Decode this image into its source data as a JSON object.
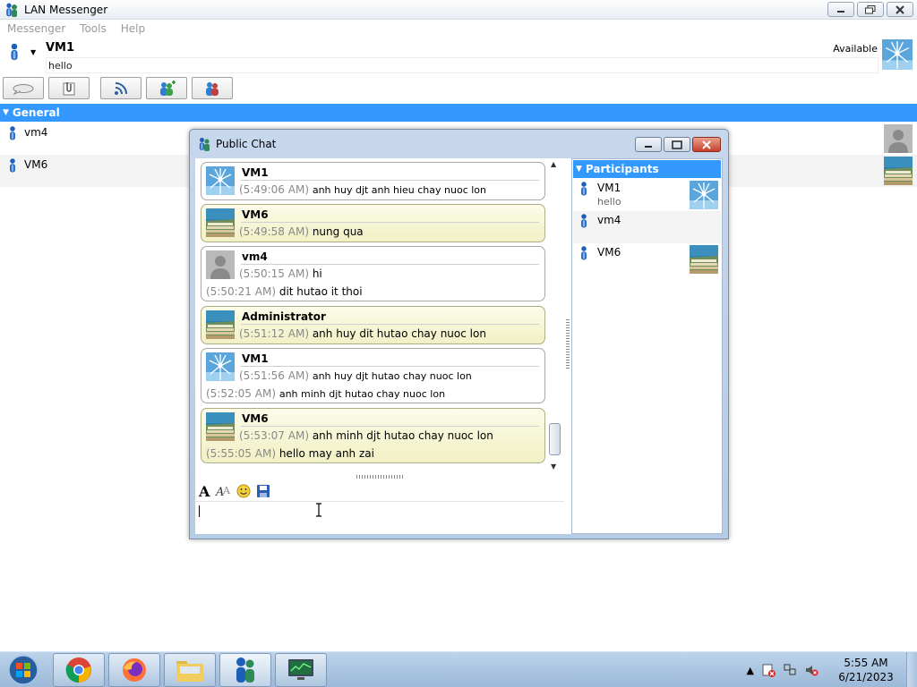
{
  "window": {
    "title": "LAN Messenger"
  },
  "menu": [
    "Messenger",
    "Tools",
    "Help"
  ],
  "profile": {
    "name": "VM1",
    "status_message": "hello",
    "availability": "Available"
  },
  "groups": [
    {
      "name": "General",
      "buddies": [
        {
          "name": "vm4",
          "avatar": "default-person-icon"
        },
        {
          "name": "VM6",
          "avatar": "stairs-photo"
        }
      ]
    }
  ],
  "chat": {
    "title": "Public Chat",
    "messages": [
      {
        "sender": "VM1",
        "avatar": "windmill-photo",
        "lines": [
          {
            "time": "(5:49:06 AM)",
            "text": "anh huy djt anh hieu chay nuoc lon"
          }
        ]
      },
      {
        "sender": "VM6",
        "avatar": "stairs-photo",
        "lines": [
          {
            "time": "(5:49:58 AM)",
            "text": "nung qua"
          }
        ]
      },
      {
        "sender": "vm4",
        "avatar": "default-person-icon",
        "lines": [
          {
            "time": "(5:50:15 AM)",
            "text": "hi"
          },
          {
            "time": "(5:50:21 AM)",
            "text": "dit hutao it thoi"
          }
        ]
      },
      {
        "sender": "Administrator",
        "avatar": "stairs-photo",
        "lines": [
          {
            "time": "(5:51:12 AM)",
            "text": "anh huy dit hutao chay nuoc lon"
          }
        ]
      },
      {
        "sender": "VM1",
        "avatar": "windmill-photo",
        "lines": [
          {
            "time": "(5:51:56 AM)",
            "text": "anh huy djt hutao chay nuoc lon"
          },
          {
            "time": "(5:52:05 AM)",
            "text": "anh minh djt hutao chay nuoc lon"
          }
        ]
      },
      {
        "sender": "VM6",
        "avatar": "stairs-photo",
        "lines": [
          {
            "time": "(5:53:07 AM)",
            "text": "anh minh djt hutao chay nuoc lon"
          },
          {
            "time": "(5:55:05 AM)",
            "text": "hello may anh zai"
          }
        ]
      }
    ],
    "input_value": "",
    "participants_header": "Participants",
    "participants": [
      {
        "name": "VM1",
        "status": "hello",
        "avatar": "windmill-photo"
      },
      {
        "name": "vm4",
        "status": "",
        "avatar": ""
      },
      {
        "name": "VM6",
        "status": "",
        "avatar": "stairs-photo"
      }
    ]
  },
  "taskbar": {
    "time": "5:55 AM",
    "date": "6/21/2023"
  },
  "colors": {
    "accent": "#3399ff",
    "bubble_yellow": "#f3f2cc",
    "timestamp": "#888888"
  }
}
